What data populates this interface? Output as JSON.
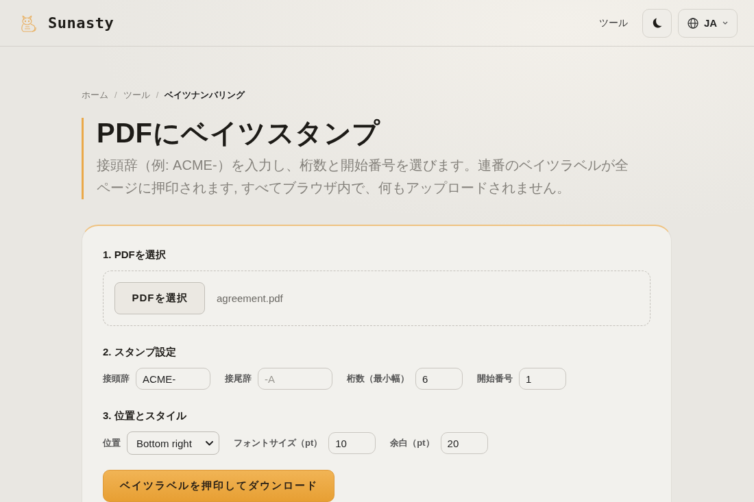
{
  "header": {
    "brand": "Sunasty",
    "nav": [
      {
        "label": "ツール"
      }
    ],
    "language": "JA"
  },
  "breadcrumb": [
    {
      "label": "ホーム",
      "separator": "/",
      "current": false
    },
    {
      "label": "ツール",
      "separator": "/",
      "current": false
    },
    {
      "label": "ベイツナンバリング",
      "current": true
    }
  ],
  "intro": {
    "title": "PDFにベイツスタンプ",
    "description": "接頭辞（例: ACME-）を入力し、桁数と開始番号を選びます。連番のベイツラベルが全ページに押印されます, すべてブラウザ内で、何もアップロードされません。"
  },
  "sections": [
    {
      "kind": "file",
      "heading": "1. PDFを選択",
      "button": "PDFを選択",
      "filename": "agreement.pdf"
    },
    {
      "kind": "fields",
      "heading": "2. スタンプ設定",
      "fields": [
        {
          "kind": "text",
          "label": "接頭辞",
          "value": "ACME-"
        },
        {
          "kind": "text",
          "label": "接尾辞",
          "placeholder": "-A"
        },
        {
          "kind": "number",
          "label": "桁数（最小幅）",
          "value": "6"
        },
        {
          "kind": "number",
          "label": "開始番号",
          "value": "1"
        }
      ]
    },
    {
      "kind": "fields",
      "heading": "3. 位置とスタイル",
      "fields": [
        {
          "kind": "select",
          "label": "位置",
          "value": "Bottom right"
        },
        {
          "kind": "number",
          "label": "フォントサイズ（pt）",
          "value": "10"
        },
        {
          "kind": "number",
          "label": "余白（pt）",
          "value": "20"
        }
      ]
    }
  ],
  "submit": "ベイツラベルを押印してダウンロード"
}
